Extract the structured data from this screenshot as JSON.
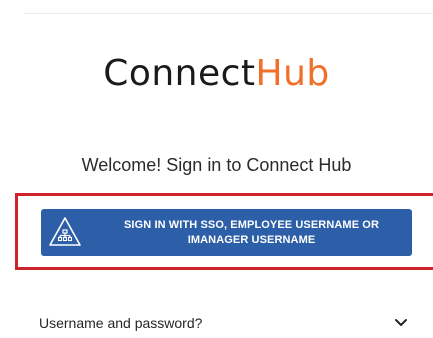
{
  "logo": {
    "part1": "Connect",
    "part2": "Hub"
  },
  "welcome_text": "Welcome! Sign in to Connect Hub",
  "sso_button": {
    "label_line1": "SIGN IN WITH SSO, EMPLOYEE USERNAME OR",
    "label_line2": "IMANAGER USERNAME",
    "icon": "sitemap-warning-icon"
  },
  "alt_login": {
    "label": "Username and password?",
    "icon": "chevron-down-icon"
  },
  "colors": {
    "brand_dark": "#1a1a1a",
    "brand_accent": "#f0702a",
    "button_blue": "#2d5fa8",
    "highlight_red": "#d0222a"
  }
}
